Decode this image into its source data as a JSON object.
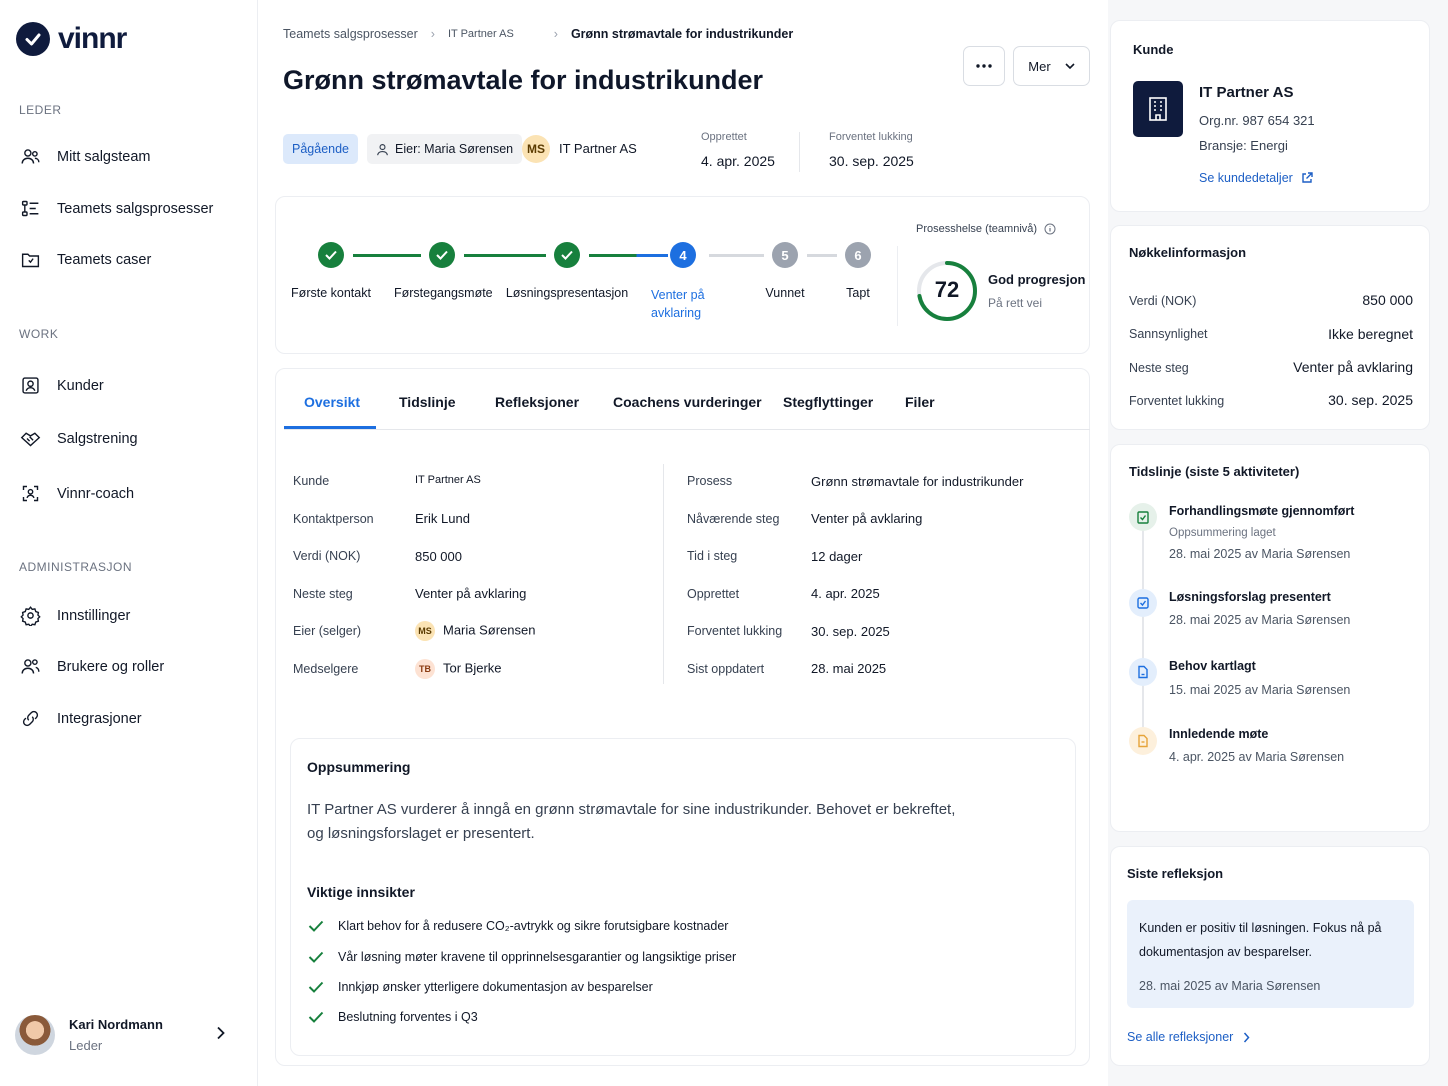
{
  "brand": {
    "name": "vinnr"
  },
  "sidebar": {
    "sections": [
      {
        "title": "LEDER",
        "items": [
          "Mitt salgsteam",
          "Teamets salgsprosesser",
          "Teamets caser"
        ]
      },
      {
        "title": "WORK",
        "items": [
          "Kunder",
          "Salgstrening",
          "Vinnr-coach"
        ]
      },
      {
        "title": "ADMINISTRASJON",
        "items": [
          "Innstillinger",
          "Brukere og roller",
          "Integrasjoner"
        ]
      }
    ],
    "user": {
      "name": "Kari Nordmann",
      "role": "Leder"
    }
  },
  "breadcrumb": [
    "Teamets salgsprosesser",
    "IT Partner AS",
    "Grønn strømavtale for industrikunder"
  ],
  "header": {
    "title": "Grønn strømavtale for industrikunder",
    "more_label": "Mer",
    "status": "Pågående",
    "owner": "Eier: Maria Sørensen",
    "customer_initials": "MS",
    "customer": "IT Partner AS",
    "created_label": "Opprettet",
    "created_value": "4. apr. 2025",
    "close_label": "Forventet lukking",
    "close_value": "30. sep. 2025"
  },
  "process": {
    "steps": [
      {
        "label": "Første kontakt",
        "state": "done"
      },
      {
        "label": "Førstegangsmøte",
        "state": "done"
      },
      {
        "label": "Løsningspresentasjon",
        "state": "done"
      },
      {
        "num": "4",
        "label": "Venter på avklaring",
        "state": "active"
      },
      {
        "num": "5",
        "label": "Vunnet",
        "state": "todo"
      },
      {
        "num": "6",
        "label": "Tapt",
        "state": "todo"
      }
    ],
    "health_label": "Prosesshelse (teamnivå)",
    "score": 72,
    "score_max": 100,
    "health_title": "God progresjon",
    "health_sub": "På rett vei",
    "colors": {
      "done": "#17803d",
      "active": "#1d6fe0",
      "todo": "#9ca3af"
    }
  },
  "tabs": [
    "Oversikt",
    "Tidslinje",
    "Refleksjoner",
    "Coachens vurderinger",
    "Stegflyttinger",
    "Filer"
  ],
  "overview": {
    "left": [
      {
        "label": "Kunde",
        "value": "IT Partner AS"
      },
      {
        "label": "Kontaktperson",
        "value": "Erik Lund"
      },
      {
        "label": "Verdi (NOK)",
        "value": "850 000"
      },
      {
        "label": "Neste steg",
        "value": "Venter på avklaring"
      },
      {
        "label": "Eier (selger)",
        "value": "Maria Sørensen",
        "initials": "MS"
      },
      {
        "label": "Medselgere",
        "value": "Tor Bjerke",
        "initials": "TB"
      }
    ],
    "right": [
      {
        "label": "Prosess",
        "value": "Grønn strømavtale for industrikunder"
      },
      {
        "label": "Nåværende steg",
        "value": "Venter på avklaring"
      },
      {
        "label": "Tid i steg",
        "value": "12 dager"
      },
      {
        "label": "Opprettet",
        "value": "4. apr. 2025"
      },
      {
        "label": "Forventet lukking",
        "value": "30. sep. 2025"
      },
      {
        "label": "Sist oppdatert",
        "value": "28. mai 2025"
      }
    ]
  },
  "summary": {
    "title": "Oppsummering",
    "text_line1": "IT Partner AS vurderer å inngå en grønn strømavtale for sine industrikunder. Behovet er bekreftet,",
    "text_line2": "og løsningsforslaget er presentert.",
    "insights_title": "Viktige innsikter",
    "insights": [
      "Klart behov for å redusere CO₂-avtrykk og sikre forutsigbare kostnader",
      "Vår løsning møter kravene til opprinnelsesgarantier og langsiktige priser",
      "Innkjøp ønsker ytterligere dokumentasjon av besparelser",
      "Beslutning forventes i Q3"
    ]
  },
  "customer_card": {
    "title": "Kunde",
    "name": "IT Partner AS",
    "org": "Org.nr. 987 654 321",
    "industry": "Bransje: Energi",
    "link": "Se kundedetaljer"
  },
  "key_info": {
    "title": "Nøkkelinformasjon",
    "rows": [
      {
        "label": "Verdi (NOK)",
        "value": "850 000"
      },
      {
        "label": "Sannsynlighet",
        "value": "Ikke beregnet"
      },
      {
        "label": "Neste steg",
        "value": "Venter på avklaring"
      },
      {
        "label": "Forventet lukking",
        "value": "30. sep. 2025"
      }
    ]
  },
  "timeline": {
    "title": "Tidslinje (siste 5 aktiviteter)",
    "items": [
      {
        "title": "Forhandlingsmøte gjennomført",
        "sub": "Oppsummering laget",
        "meta": "28. mai 2025 av Maria Sørensen"
      },
      {
        "title": "Løsningsforslag presentert",
        "meta": "28. mai 2025 av Maria Sørensen"
      },
      {
        "title": "Behov kartlagt",
        "meta": "15. mai 2025 av Maria Sørensen"
      },
      {
        "title": "Innledende møte",
        "meta": "4. apr. 2025 av Maria Sørensen"
      }
    ]
  },
  "reflection": {
    "title": "Siste refleksjon",
    "text_line1": "Kunden er positiv til løsningen. Fokus nå på",
    "text_line2": "dokumentasjon av besparelser.",
    "meta": "28. mai 2025 av Maria Sørensen",
    "link": "Se alle refleksjoner"
  }
}
